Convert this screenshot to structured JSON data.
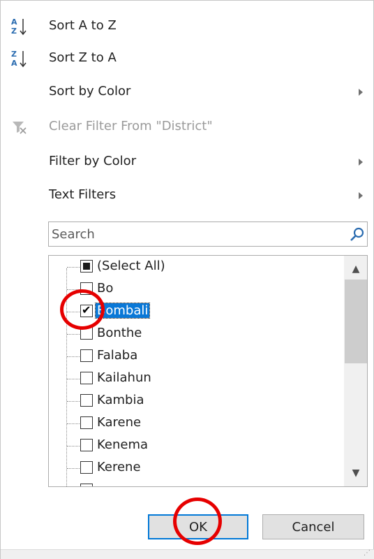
{
  "menu": {
    "sort_asc": {
      "label": "Sort A to Z",
      "icon": "sort-a-to-z-icon"
    },
    "sort_desc": {
      "label": "Sort Z to A",
      "icon": "sort-z-to-a-icon"
    },
    "sort_by_color": {
      "label": "Sort by Color"
    },
    "clear_filter": {
      "label": "Clear Filter From \"District\"",
      "icon": "clear-filter-icon",
      "disabled": true
    },
    "filter_by_color": {
      "label": "Filter by Color"
    },
    "text_filters": {
      "label": "Text Filters"
    }
  },
  "search": {
    "placeholder": "Search"
  },
  "list": {
    "items": [
      {
        "label": "(Select All)",
        "state": "partial"
      },
      {
        "label": "Bo",
        "state": "unchecked"
      },
      {
        "label": "Bombali",
        "state": "checked",
        "selected": true
      },
      {
        "label": "Bonthe",
        "state": "unchecked"
      },
      {
        "label": "Falaba",
        "state": "unchecked"
      },
      {
        "label": "Kailahun",
        "state": "unchecked"
      },
      {
        "label": "Kambia",
        "state": "unchecked"
      },
      {
        "label": "Karene",
        "state": "unchecked"
      },
      {
        "label": "Kenema",
        "state": "unchecked"
      },
      {
        "label": "Kerene",
        "state": "unchecked"
      }
    ]
  },
  "buttons": {
    "ok": "OK",
    "cancel": "Cancel"
  },
  "colors": {
    "accent": "#0078d7",
    "selection": "#0a78d7",
    "annotation": "#e60000"
  }
}
